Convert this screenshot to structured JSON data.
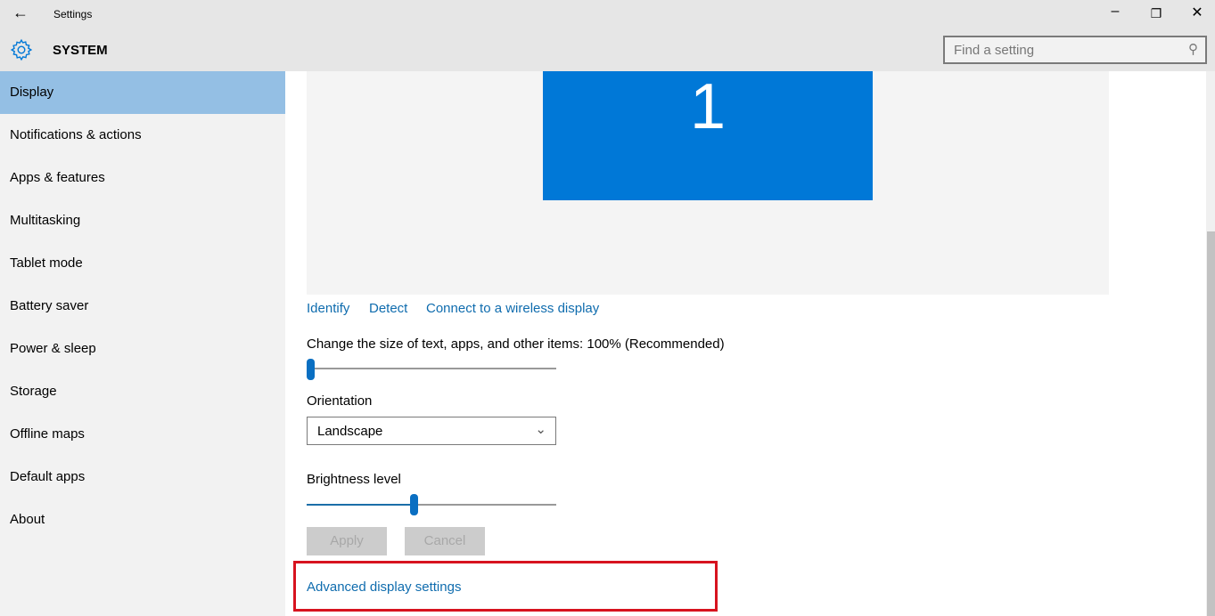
{
  "window": {
    "title": "Settings",
    "back_icon": "arrow-left-icon"
  },
  "header": {
    "section": "SYSTEM",
    "section_icon": "gear-icon",
    "accent": "#0078d7"
  },
  "search": {
    "placeholder": "Find a setting"
  },
  "sidebar": {
    "items": [
      {
        "label": "Display",
        "active": true
      },
      {
        "label": "Notifications & actions"
      },
      {
        "label": "Apps & features"
      },
      {
        "label": "Multitasking"
      },
      {
        "label": "Tablet mode"
      },
      {
        "label": "Battery saver"
      },
      {
        "label": "Power & sleep"
      },
      {
        "label": "Storage"
      },
      {
        "label": "Offline maps"
      },
      {
        "label": "Default apps"
      },
      {
        "label": "About"
      }
    ]
  },
  "main": {
    "monitor_label": "1",
    "links": {
      "identify": "Identify",
      "detect": "Detect",
      "wireless": "Connect to a wireless display"
    },
    "scale": {
      "label": "Change the size of text, apps, and other items: 100% (Recommended)",
      "value_percent": 0
    },
    "orientation": {
      "label": "Orientation",
      "value": "Landscape"
    },
    "brightness": {
      "label": "Brightness level",
      "value_percent": 40
    },
    "apply": "Apply",
    "cancel": "Cancel",
    "advanced": "Advanced display settings",
    "highlight_color": "#d7131f"
  }
}
